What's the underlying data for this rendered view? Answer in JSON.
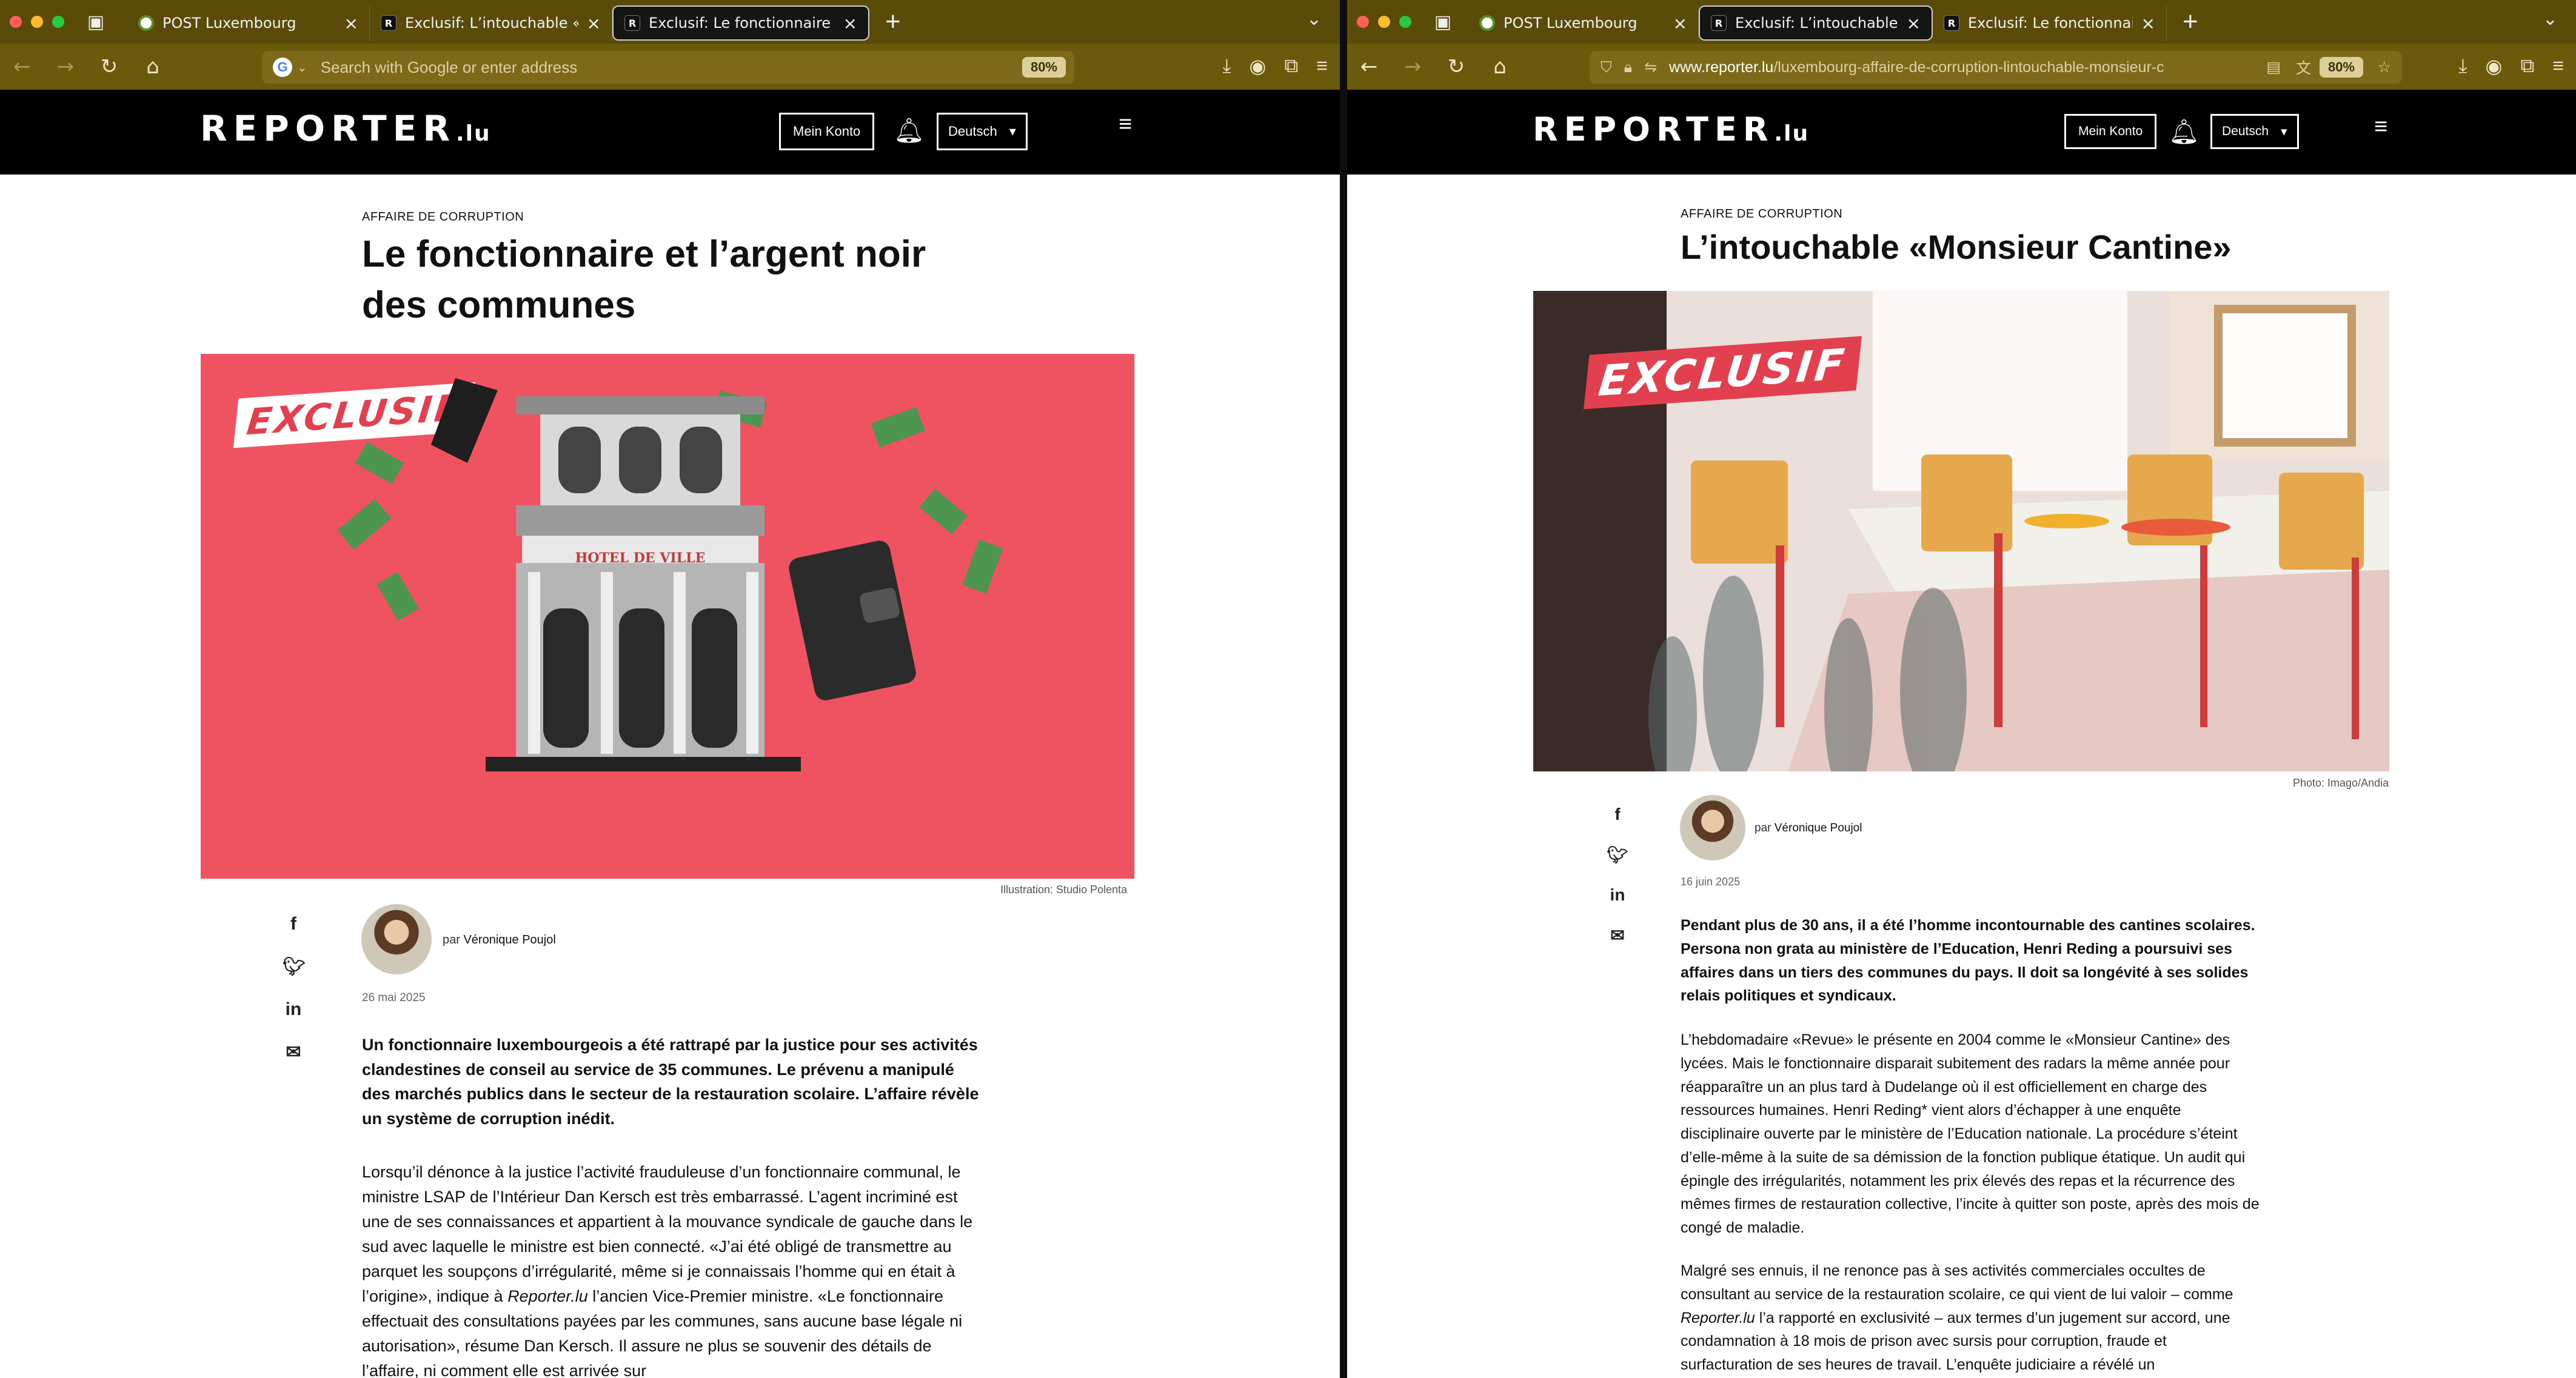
{
  "left": {
    "tabs": [
      {
        "label": "POST Luxembourg",
        "fav": "post"
      },
      {
        "label": "Exclusif: L’intouchable «Monsie",
        "fav": "R"
      },
      {
        "label": "Exclusif: Le fonctionnaire et l’arg",
        "fav": "R"
      }
    ],
    "url_placeholder": "Search with Google or enter address",
    "zoom": "80%",
    "site": {
      "logo": "REPORTER",
      "logo_suffix": ".lu",
      "account": "Mein Konto",
      "language": "Deutsch"
    },
    "article": {
      "kicker": "AFFAIRE DE CORRUPTION",
      "title": "Le fonctionnaire et l’argent noir des communes",
      "image_badge": "EXCLUSIF",
      "image_sign": "HOTEL DE VILLE",
      "caption": "Illustration: Studio Polenta",
      "by_prefix": "par",
      "author": "Véronique Poujol",
      "date": "26 mai 2025",
      "lead": "Un fonctionnaire luxembourgeois a été rattrapé par la justice pour ses activités clandestines de conseil au service de 35 communes. Le prévenu a manipulé des marchés publics dans le secteur de la restauration scolaire. L’affaire révèle un système de corruption inédit.",
      "body1": "Lorsqu’il dénonce à la justice l’activité frauduleuse d’un fonctionnaire communal, le ministre LSAP de l’Intérieur Dan Kersch est très embarrassé. L’agent incriminé est une de ses connaissances et appartient à la mouvance syndicale de gauche dans le sud avec laquelle le ministre est bien connecté. «J’ai été obligé de transmettre au parquet les soupçons d’irrégularité, même si je connaissais l’homme qui en était à l’origine», indique à",
      "body1_em": "Reporter.lu",
      "body1_end": "l’ancien Vice-Premier ministre. «Le fonctionnaire effectuait des consultations payées par les communes, sans aucune base légale ni autorisation», résume Dan Kersch. Il assure ne plus se souvenir des détails de l’affaire, ni comment elle est arrivée sur"
    }
  },
  "right": {
    "tabs": [
      {
        "label": "POST Luxembourg",
        "fav": "post"
      },
      {
        "label": "Exclusif: L’intouchable «Monsie",
        "fav": "R"
      },
      {
        "label": "Exclusif: Le fonctionnaire et l’ar",
        "fav": "R"
      }
    ],
    "url_host": "www.reporter.lu",
    "url_path": "/luxembourg-affaire-de-corruption-lintouchable-monsieur-c",
    "zoom": "80%",
    "site": {
      "logo": "REPORTER",
      "logo_suffix": ".lu",
      "account": "Mein Konto",
      "language": "Deutsch"
    },
    "article": {
      "kicker": "AFFAIRE DE CORRUPTION",
      "title": "L’intouchable «Monsieur Cantine»",
      "image_badge": "EXCLUSIF",
      "caption": "Photo: Imago/Andia",
      "by_prefix": "par",
      "author": "Véronique Poujol",
      "date": "16 juin 2025",
      "lead": "Pendant plus de 30 ans, il a été l’homme incontournable des cantines scolaires. Persona non grata au ministère de l’Education, Henri Reding a poursuivi ses affaires dans un tiers des communes du pays. Il doit sa longévité à ses solides relais politiques et syndicaux.",
      "body1": "L’hebdomadaire «Revue» le présente en 2004 comme le «Monsieur Cantine» des lycées. Mais le fonctionnaire disparait subitement des radars la même année pour réapparaître un an plus tard à Dudelange où il est officiellement en charge des ressources humaines. Henri Reding* vient alors d’échapper à une enquête disciplinaire ouverte par le ministère de l’Education nationale. La procédure s’éteint d’elle-même à la suite de sa démission de la fonction publique étatique. Un audit qui épingle des irrégularités, notamment les prix élevés des repas et la récurrence des mêmes firmes de restauration collective, l’incite à quitter son poste, après des mois de congé de maladie.",
      "body2": "Malgré ses ennuis, il ne renonce pas à ses activités commerciales occultes de consultant au service de la restauration scolaire, ce qui vient de lui valoir – comme",
      "body2_em": "Reporter.lu",
      "body2_end": "l’a rapporté en exclusivité – aux termes d’un jugement sur accord, une condamnation à 18 mois de prison avec sursis pour corruption, fraude et surfacturation de ses heures de travail. L’enquête judiciaire a révélé un"
    }
  },
  "colors": {
    "chrome_tab": "#5a4b0a",
    "chrome_nav": "#6b5a0c",
    "illustration_bg": "#ef5261",
    "badge_red": "#e2404f"
  }
}
